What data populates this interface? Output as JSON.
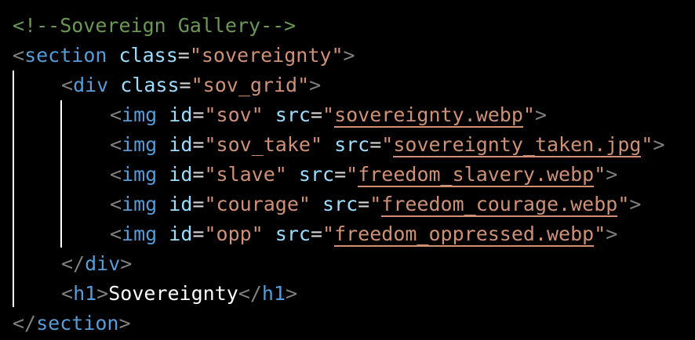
{
  "editor": {
    "lines": [
      {
        "indent": 0,
        "type": "comment",
        "text": "<!--Sovereign Gallery-->"
      },
      {
        "indent": 0,
        "type": "open",
        "tag": "section",
        "attr": "class",
        "value": "sovereignty"
      },
      {
        "indent": 1,
        "type": "open",
        "tag": "div",
        "attr": "class",
        "value": "sov_grid"
      },
      {
        "indent": 2,
        "type": "img",
        "tag": "img",
        "id": "sov",
        "src": "sovereignty.webp"
      },
      {
        "indent": 2,
        "type": "img",
        "tag": "img",
        "id": "sov_take",
        "src": "sovereignty_taken.jpg"
      },
      {
        "indent": 2,
        "type": "img",
        "tag": "img",
        "id": "slave",
        "src": "freedom_slavery.webp"
      },
      {
        "indent": 2,
        "type": "img",
        "tag": "img",
        "id": "courage",
        "src": "freedom_courage.webp"
      },
      {
        "indent": 2,
        "type": "img",
        "tag": "img",
        "id": "opp",
        "src": "freedom_oppressed.webp"
      },
      {
        "indent": 1,
        "type": "close",
        "tag": "div"
      },
      {
        "indent": 1,
        "type": "textel",
        "tag": "h1",
        "text": "Sovereignty"
      },
      {
        "indent": 0,
        "type": "close",
        "tag": "section"
      }
    ]
  },
  "colors": {
    "background": "#000000",
    "comment": "#6a9955",
    "bracket": "#808080",
    "tag": "#569cd6",
    "attribute": "#9cdcfe",
    "string": "#ce9178",
    "text": "#ffffff"
  }
}
